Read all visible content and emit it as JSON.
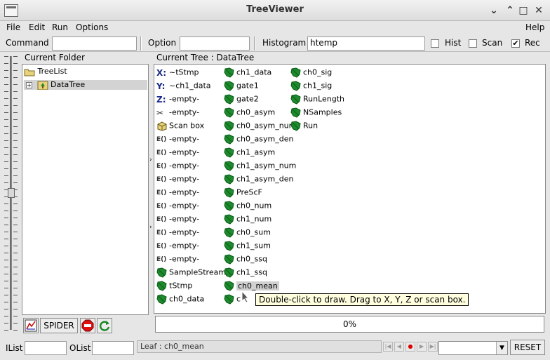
{
  "window": {
    "title": "TreeViewer"
  },
  "menu": {
    "file": "File",
    "edit": "Edit",
    "run": "Run",
    "options": "Options",
    "help": "Help"
  },
  "toolbar": {
    "command_label": "Command",
    "command_value": "",
    "option_label": "Option",
    "option_value": "",
    "histogram_label": "Histogram",
    "histogram_value": "htemp",
    "hist_label": "Hist",
    "hist_checked": false,
    "scan_label": "Scan",
    "scan_checked": false,
    "rec_label": "Rec",
    "rec_checked": true,
    "rec_check": "✔"
  },
  "folder": {
    "header": "Current Folder",
    "nodes": [
      {
        "label": "TreeList",
        "icon": "folder-icon"
      },
      {
        "label": "DataTree",
        "icon": "tree-icon",
        "selected": true,
        "expander": "+"
      }
    ]
  },
  "buttons": {
    "spider": "SPIDER"
  },
  "tree": {
    "header": "Current Tree : DataTree",
    "col1": [
      {
        "label": "~tStmp",
        "icon": "x-axis-icon",
        "glyph": "X:"
      },
      {
        "label": "~ch1_data",
        "icon": "y-axis-icon",
        "glyph": "Y:"
      },
      {
        "label": "-empty-",
        "icon": "z-axis-icon",
        "glyph": "Z:"
      },
      {
        "label": "-empty-",
        "icon": "scissors-cut-icon",
        "glyph": "✂"
      },
      {
        "label": "Scan box",
        "icon": "scan-box-icon",
        "glyph": ""
      },
      {
        "label": "-empty-",
        "icon": "expression-icon",
        "glyph": "E()"
      },
      {
        "label": "-empty-",
        "icon": "expression-icon",
        "glyph": "E()"
      },
      {
        "label": "-empty-",
        "icon": "expression-icon",
        "glyph": "E()"
      },
      {
        "label": "-empty-",
        "icon": "expression-icon",
        "glyph": "E()"
      },
      {
        "label": "-empty-",
        "icon": "expression-icon",
        "glyph": "E()"
      },
      {
        "label": "-empty-",
        "icon": "expression-icon",
        "glyph": "E()"
      },
      {
        "label": "-empty-",
        "icon": "expression-icon",
        "glyph": "E()"
      },
      {
        "label": "-empty-",
        "icon": "expression-icon",
        "glyph": "E()"
      },
      {
        "label": "-empty-",
        "icon": "expression-icon",
        "glyph": "E()"
      },
      {
        "label": "-empty-",
        "icon": "expression-icon",
        "glyph": "E()"
      },
      {
        "label": "SampleStream",
        "icon": "branch-icon",
        "glyph": ""
      },
      {
        "label": "tStmp",
        "icon": "leaf-icon",
        "glyph": ""
      },
      {
        "label": "ch0_data",
        "icon": "leaf-icon",
        "glyph": ""
      }
    ],
    "col2": [
      {
        "label": "ch1_data"
      },
      {
        "label": "gate1"
      },
      {
        "label": "gate2"
      },
      {
        "label": "ch0_asym"
      },
      {
        "label": "ch0_asym_num"
      },
      {
        "label": "ch0_asym_den"
      },
      {
        "label": "ch1_asym"
      },
      {
        "label": "ch1_asym_num"
      },
      {
        "label": "ch1_asym_den"
      },
      {
        "label": "PreScF"
      },
      {
        "label": "ch0_num"
      },
      {
        "label": "ch1_num"
      },
      {
        "label": "ch0_sum"
      },
      {
        "label": "ch1_sum"
      },
      {
        "label": "ch0_ssq"
      },
      {
        "label": "ch1_ssq"
      },
      {
        "label": "ch0_mean",
        "highlighted": true
      },
      {
        "label": "c"
      }
    ],
    "col3": [
      {
        "label": "ch0_sig"
      },
      {
        "label": "ch1_sig"
      },
      {
        "label": "RunLength"
      },
      {
        "label": "NSamples"
      },
      {
        "label": "Run"
      }
    ]
  },
  "tooltip": "Double-click to draw. Drag to X, Y, Z or scan box.",
  "progress": {
    "text": "0%",
    "fraction": 0
  },
  "status": {
    "ilist_label": "IList",
    "ilist_value": "",
    "olist_label": "OList",
    "olist_value": "",
    "message": "Leaf : ch0_mean",
    "reset_label": "RESET"
  }
}
